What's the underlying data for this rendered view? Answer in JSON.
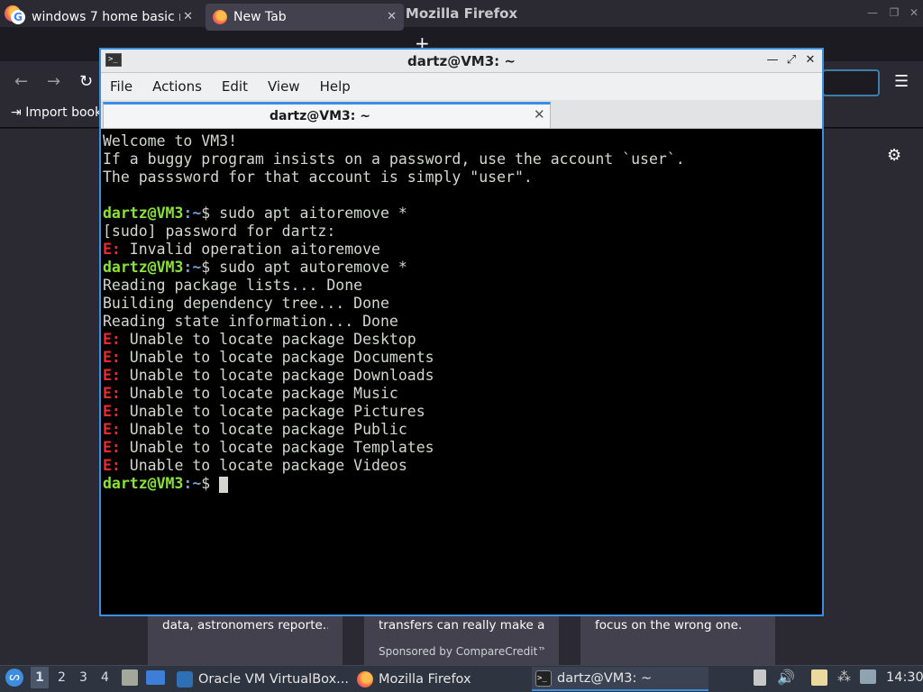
{
  "firefox": {
    "window_title": "Mozilla Firefox",
    "tabs": [
      {
        "label": "windows 7 home basic r",
        "favicon": "google-icon"
      },
      {
        "label": "New Tab",
        "favicon": "firefox-icon"
      }
    ],
    "bookmarks": {
      "import_label": "Import book"
    },
    "cards": [
      {
        "text": "data, astronomers reporte..."
      },
      {
        "text": "transfers can really make a...",
        "sponsor": "Sponsored by CompareCredit™"
      },
      {
        "text": "focus on the wrong one."
      }
    ]
  },
  "terminal": {
    "title": "dartz@VM3: ~",
    "menu": [
      "File",
      "Actions",
      "Edit",
      "View",
      "Help"
    ],
    "tab_label": "dartz@VM3: ~",
    "prompt_user": "dartz@VM3",
    "prompt_path": ":~",
    "prompt_symbol": "$ ",
    "error_prefix": "E:",
    "lines": {
      "welcome1": "Welcome to VM3!",
      "welcome2": "If a buggy program insists on a password, use the account `user`.",
      "welcome3": "The passsword for that account is simply \"user\".",
      "cmd1": "sudo apt aitoremove *",
      "sudo_prompt": "[sudo] password for dartz:",
      "err1": " Invalid operation aitoremove",
      "cmd2": "sudo apt autoremove *",
      "out1": "Reading package lists... Done",
      "out2": "Building dependency tree... Done",
      "out3": "Reading state information... Done",
      "err_desktop": " Unable to locate package Desktop",
      "err_documents": " Unable to locate package Documents",
      "err_downloads": " Unable to locate package Downloads",
      "err_music": " Unable to locate package Music",
      "err_pictures": " Unable to locate package Pictures",
      "err_public": " Unable to locate package Public",
      "err_templates": " Unable to locate package Templates",
      "err_videos": " Unable to locate package Videos"
    }
  },
  "taskbar": {
    "workspaces": [
      "1",
      "2",
      "3",
      "4"
    ],
    "tasks": [
      {
        "label": "Oracle VM VirtualBox...",
        "icon": "virtualbox-icon"
      },
      {
        "label": "Mozilla Firefox",
        "icon": "firefox-icon"
      },
      {
        "label": "dartz@VM3: ~",
        "icon": "terminal-icon"
      }
    ],
    "clock": "14:30"
  },
  "colors": {
    "terminal_accent": "#3d8ee0",
    "prompt_green": "#8ae234",
    "path_blue": "#729fcf",
    "error_red": "#ef2929"
  }
}
